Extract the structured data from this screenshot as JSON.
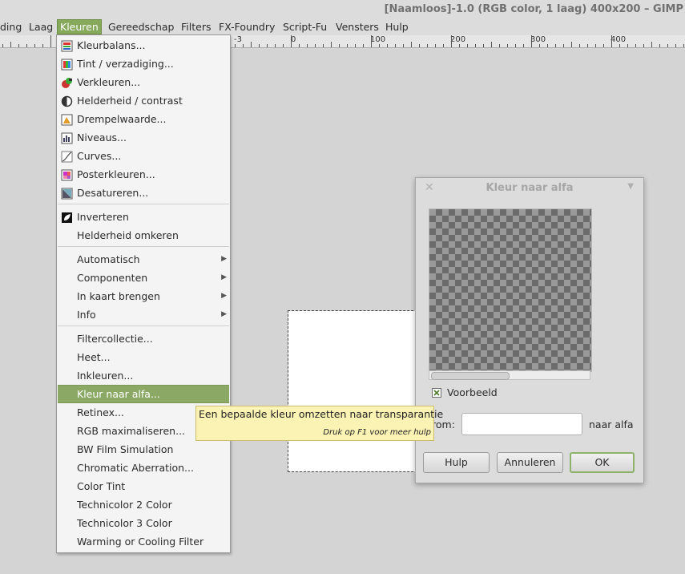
{
  "window": {
    "title": "[Naamloos]-1.0 (RGB color, 1 laag) 400x200 – GIMP"
  },
  "menubar": [
    {
      "label": "ding",
      "active": false
    },
    {
      "label": "Laag",
      "active": false
    },
    {
      "label": "Kleuren",
      "active": true
    },
    {
      "label": "Gereedschap",
      "active": false
    },
    {
      "label": "Filters",
      "active": false
    },
    {
      "label": "FX-Foundry",
      "active": false
    },
    {
      "label": "Script-Fu",
      "active": false
    },
    {
      "label": "Vensters",
      "active": false
    },
    {
      "label": "Hulp",
      "active": false
    }
  ],
  "ruler": {
    "labels": [
      "-3",
      "0",
      "100",
      "200",
      "300",
      "400"
    ]
  },
  "colors_menu": {
    "items": [
      {
        "label": "Kleurbalans...",
        "icon": "color-balance-icon"
      },
      {
        "label": "Tint / verzadiging...",
        "icon": "hue-saturation-icon"
      },
      {
        "label": "Verkleuren...",
        "icon": "colorize-icon"
      },
      {
        "label": "Helderheid / contrast",
        "icon": "brightness-contrast-icon"
      },
      {
        "label": "Drempelwaarde...",
        "icon": "threshold-icon"
      },
      {
        "label": "Niveaus...",
        "icon": "levels-icon"
      },
      {
        "label": "Curves...",
        "icon": "curves-icon"
      },
      {
        "label": "Posterkleuren...",
        "icon": "posterize-icon"
      },
      {
        "label": "Desatureren...",
        "icon": "desaturate-icon"
      },
      {
        "label": "Inverteren",
        "icon": "invert-icon"
      },
      {
        "label": "Helderheid omkeren"
      },
      {
        "label": "Automatisch",
        "submenu": true
      },
      {
        "label": "Componenten",
        "submenu": true
      },
      {
        "label": "In kaart brengen",
        "submenu": true
      },
      {
        "label": "Info",
        "submenu": true
      },
      {
        "label": "Filtercollectie..."
      },
      {
        "label": "Heet..."
      },
      {
        "label": "Inkleuren..."
      },
      {
        "label": "Kleur naar alfa...",
        "highlighted": true
      },
      {
        "label": "Retinex..."
      },
      {
        "label": "RGB maximaliseren..."
      },
      {
        "label": "BW Film Simulation"
      },
      {
        "label": "Chromatic Aberration..."
      },
      {
        "label": "Color Tint"
      },
      {
        "label": "Technicolor 2 Color"
      },
      {
        "label": "Technicolor 3 Color"
      },
      {
        "label": "Warming or Cooling Filter"
      }
    ]
  },
  "tooltip": {
    "text": "Een bepaalde kleur omzetten naar transparantie",
    "hint": "Druk op F1 voor meer hulp"
  },
  "dialog": {
    "title": "Kleur naar alfa",
    "preview_label": "Voorbeeld",
    "preview_checked": true,
    "from_label": "rom:",
    "to_label": "naar alfa",
    "from_color": "#ffffff",
    "buttons": {
      "help": "Hulp",
      "cancel": "Annuleren",
      "ok": "OK"
    }
  },
  "colors": {
    "accent": "#86a95c",
    "tooltip_bg": "#fbf3b4"
  }
}
